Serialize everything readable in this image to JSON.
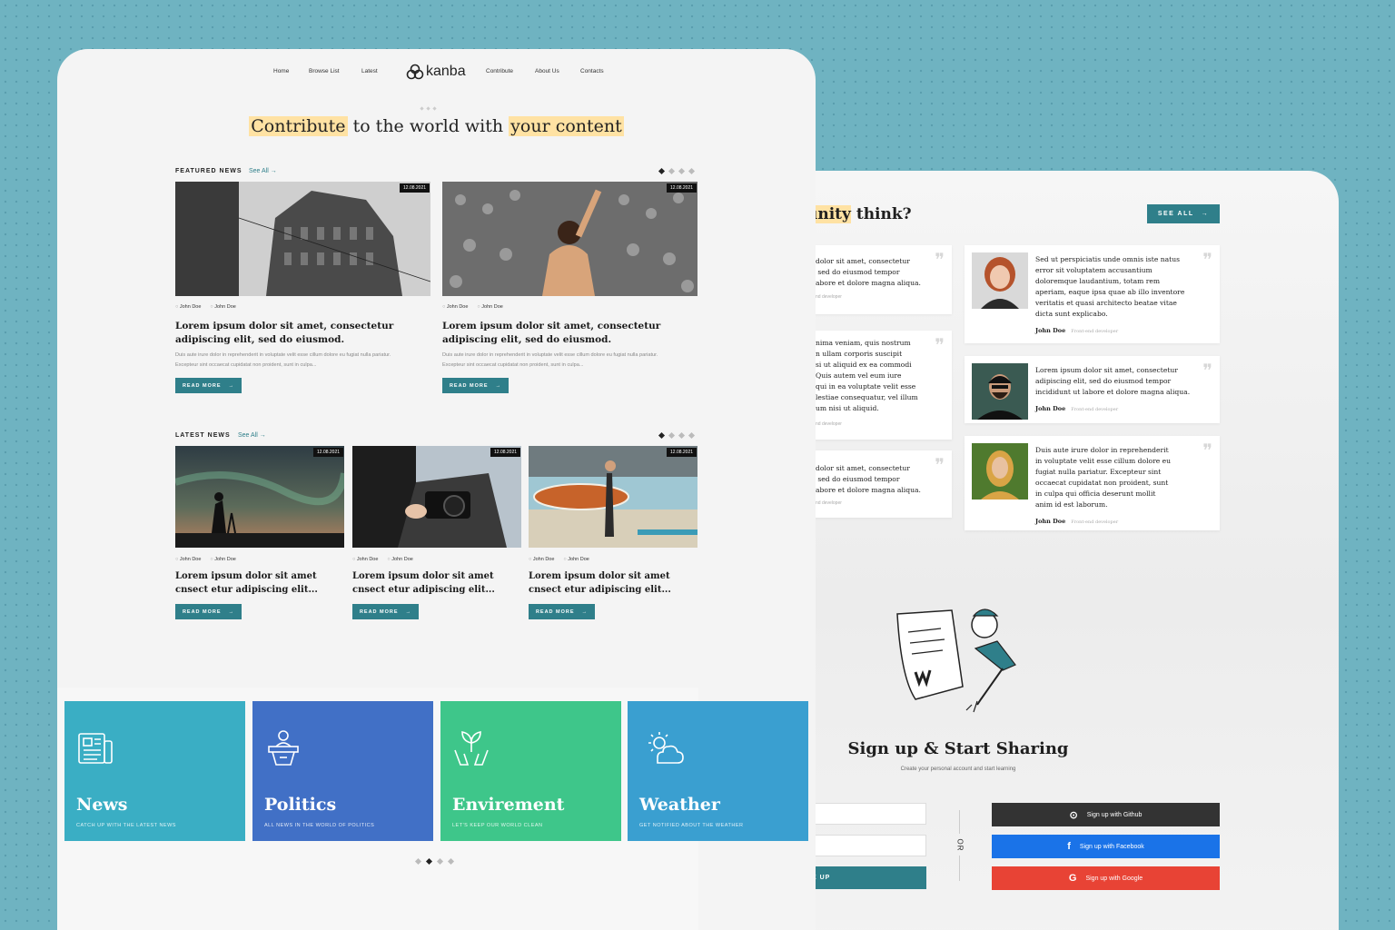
{
  "nav": {
    "items": [
      "Home",
      "Browse List",
      "Latest",
      "Contribute",
      "About Us",
      "Contacts"
    ],
    "logo": "kanba"
  },
  "hero": {
    "part1": "Contribute",
    "part2": " to the world with ",
    "part3": "your content"
  },
  "featured": {
    "label": "FEATURED NEWS",
    "see_all": "See All",
    "cards": [
      {
        "date": "12.08.2021",
        "author": "John Doe",
        "comments": "John Doe",
        "title": "Lorem ipsum dolor sit amet, consectetur adipiscing elit, sed do eiusmod.",
        "desc": "Duis aute irure dolor in reprehenderit in voluptate velit esse cillum dolore eu fugiat nulla pariatur. Excepteur sint occaecat cupidatat non proident, sunt in culpa...",
        "button": "READ MORE"
      },
      {
        "date": "12.08.2021",
        "author": "John Doe",
        "comments": "John Doe",
        "title": "Lorem ipsum dolor sit amet, consectetur adipiscing elit, sed do eiusmod.",
        "desc": "Duis aute irure dolor in reprehenderit in voluptate velit esse cillum dolore eu fugiat nulla pariatur. Excepteur sint occaecat cupidatat non proident, sunt in culpa...",
        "button": "READ MORE"
      }
    ]
  },
  "latest": {
    "label": "LATEST NEWS",
    "see_all": "See All",
    "cards": [
      {
        "date": "12.08.2021",
        "author": "John Doe",
        "comments": "John Doe",
        "title": "Lorem ipsum dolor sit amet cnsect etur adipiscing elit...",
        "button": "READ MORE"
      },
      {
        "date": "12.08.2021",
        "author": "John Doe",
        "comments": "John Doe",
        "title": "Lorem ipsum dolor sit amet cnsect etur adipiscing elit...",
        "button": "READ MORE"
      },
      {
        "date": "12.08.2021",
        "author": "John Doe",
        "comments": "John Doe",
        "title": "Lorem ipsum dolor sit amet cnsect etur adipiscing elit...",
        "button": "READ MORE"
      }
    ]
  },
  "categories": [
    {
      "name": "News",
      "sub": "CATCH UP WITH THE LATEST NEWS",
      "color": "#3aaec4"
    },
    {
      "name": "Politics",
      "sub": "ALL NEWS IN THE WORLD OF POLITICS",
      "color": "#4170c6"
    },
    {
      "name": "Envirement",
      "sub": "LET'S KEEP OUR WORLD CLEAN",
      "color": "#3ec68a"
    },
    {
      "name": "Weather",
      "sub": "GET NOTIFIED ABOUT THE WEATHER",
      "color": "#3a9fd0"
    }
  ],
  "community": {
    "heading_hl": "unity",
    "heading_rest": " think?",
    "see_all": "SEE ALL",
    "left_cards": [
      {
        "text": "dolor sit amet, consectetur\n sed do eiusmod tempor\nabore et dolore magna aliqua.",
        "role": "nd developer"
      },
      {
        "text": "nima veniam, quis nostrum\nn ullam corporis suscipit\nsi ut aliquid ex ea commodi\nQuis autem vel eum iure\nqui in ea voluptate velit esse\nlestiae consequatur, vel illum\num nisi ut aliquid.",
        "role": "nd developer"
      },
      {
        "text": "dolor sit amet, consectetur\n sed do eiusmod tempor\nabore et dolore magna aliqua.",
        "role": "nd developer"
      }
    ],
    "cards": [
      {
        "text": "Sed ut perspiciatis unde omnis iste natus error sit voluptatem accusantium doloremque laudantium, totam rem aperiam, eaque ipsa quae ab illo inventore veritatis et quasi architecto beatae vitae dicta sunt explicabo.",
        "name": "John Doe",
        "role": "Front-end developer"
      },
      {
        "text": "Lorem ipsum dolor sit amet, consectetur adipiscing elit, sed do eiusmod tempor incididunt ut labore et dolore magna aliqua.",
        "name": "John Doe",
        "role": "Front-end developer"
      },
      {
        "text": "Duis aute irure dolor in reprehenderit in voluptate velit esse cillum dolore eu fugiat nulla pariatur. Excepteur sint occaecat cupidatat non proident, sunt in culpa qui officia deserunt mollit anim id est laborum.",
        "name": "John Doe",
        "role": "Front-end developer"
      }
    ]
  },
  "signup": {
    "title": "Sign up & Start Sharing",
    "subtitle": "Create your personal account and start learning",
    "submit": "E UP",
    "or": "OR",
    "github": "Sign up with Github",
    "facebook": "Sign up with Facebook",
    "google": "Sign up with Google",
    "github_color": "#333333",
    "facebook_color": "#1a73e8",
    "google_color": "#e84335"
  }
}
